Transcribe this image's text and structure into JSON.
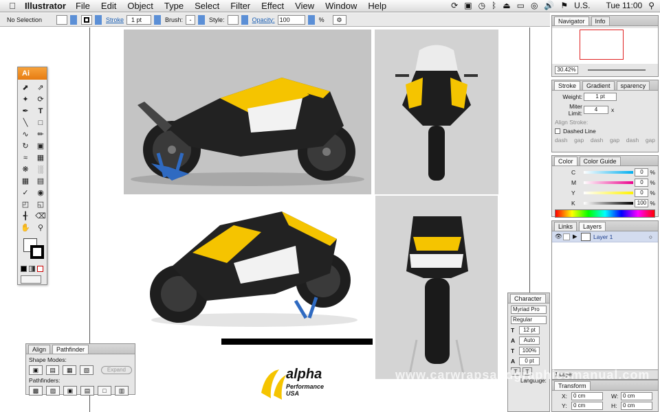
{
  "menubar": {
    "app": "Illustrator",
    "items": [
      "File",
      "Edit",
      "Object",
      "Type",
      "Select",
      "Filter",
      "Effect",
      "View",
      "Window",
      "Help"
    ],
    "input_source": "U.S.",
    "clock": "Tue 11:00"
  },
  "control": {
    "selection": "No Selection",
    "stroke_label": "Stroke",
    "stroke_value": "1 pt",
    "brush_label": "Brush:",
    "brush_value": "-",
    "style_label": "Style:",
    "opacity_label": "Opacity:",
    "opacity_value": "100",
    "percent": "%"
  },
  "toolbox": {
    "title": "Ai"
  },
  "navigator": {
    "tab1": "Navigator",
    "tab2": "Info",
    "zoom": "30.42%"
  },
  "stroke_panel": {
    "tab1": "Stroke",
    "tab2": "Gradient",
    "tab3": "sparency",
    "weight_label": "Weight:",
    "weight_value": "1 pt",
    "miter_label": "Miter Limit:",
    "miter_value": "4",
    "miter_unit": "x",
    "align_label": "Align Stroke:",
    "dashed_label": "Dashed Line",
    "dash_labels": [
      "dash",
      "gap",
      "dash",
      "gap",
      "dash",
      "gap"
    ]
  },
  "color_panel": {
    "tab1": "Color",
    "tab2": "Color Guide",
    "channels": [
      {
        "label": "C",
        "value": "0"
      },
      {
        "label": "M",
        "value": "0"
      },
      {
        "label": "Y",
        "value": "0"
      },
      {
        "label": "K",
        "value": "100"
      }
    ],
    "percent": "%"
  },
  "layers_panel": {
    "tab1": "Links",
    "tab2": "Layers",
    "layer_name": "Layer 1",
    "footer": "1 Layer"
  },
  "character_panel": {
    "tab": "Character",
    "font": "Myriad Pro",
    "style": "Regular",
    "size": "12 pt",
    "leading": "Auto",
    "scale": "100%",
    "baseline": "0 pt",
    "language_label": "Language:"
  },
  "transform_panel": {
    "tab": "Transform",
    "x_label": "X:",
    "y_label": "Y:",
    "w_label": "W:",
    "h_label": "H:",
    "x": "0 cm",
    "y": "0 cm",
    "w": "0 cm",
    "h": "0 cm"
  },
  "pathfinder_panel": {
    "tab1": "Align",
    "tab2": "Pathfinder",
    "shape_modes": "Shape Modes:",
    "expand": "Expand",
    "pathfinders": "Pathfinders:"
  },
  "logo": {
    "brand": "alpha",
    "sub": "Performance USA"
  },
  "watermark": "www.carwrapsandgraphicsmanual.com",
  "colors": {
    "accent": "#f5c400",
    "bike_dark": "#1e1e1e",
    "stand_blue": "#2f6ac1"
  }
}
